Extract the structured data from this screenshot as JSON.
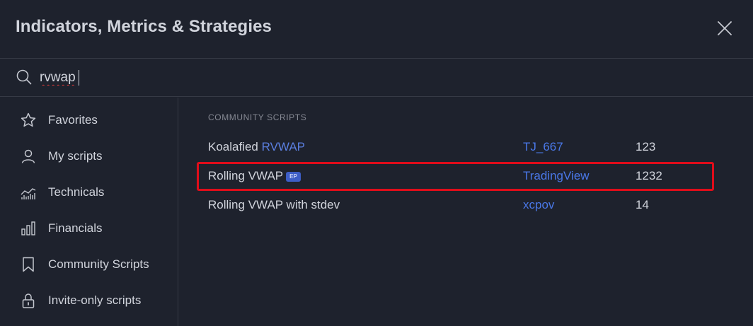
{
  "header": {
    "title": "Indicators, Metrics & Strategies",
    "close_icon": "close-icon"
  },
  "search": {
    "value": "rvwap",
    "icon": "search-icon"
  },
  "sidebar": {
    "items": [
      {
        "label": "Favorites",
        "icon": "star-icon"
      },
      {
        "label": "My scripts",
        "icon": "user-icon"
      },
      {
        "label": "Technicals",
        "icon": "technicals-chart-icon"
      },
      {
        "label": "Financials",
        "icon": "bar-chart-icon"
      },
      {
        "label": "Community Scripts",
        "icon": "bookmark-icon"
      },
      {
        "label": "Invite-only scripts",
        "icon": "lock-icon"
      }
    ]
  },
  "main": {
    "section_label": "COMMUNITY SCRIPTS",
    "rows": [
      {
        "name_prefix": "Koalafied ",
        "name_highlight": "RVWAP",
        "badge": "",
        "author": "TJ_667",
        "count": "123"
      },
      {
        "name_prefix": "Rolling VWAP",
        "name_highlight": "",
        "badge": "EP",
        "author": "TradingView",
        "count": "1232"
      },
      {
        "name_prefix": "Rolling VWAP with stdev",
        "name_highlight": "",
        "badge": "",
        "author": "xcpov",
        "count": "14"
      }
    ]
  },
  "colors": {
    "background": "#1e222d",
    "divider": "#363a45",
    "text": "#d1d4dc",
    "link": "#4a78e8",
    "annotation": "#e00d1a"
  }
}
